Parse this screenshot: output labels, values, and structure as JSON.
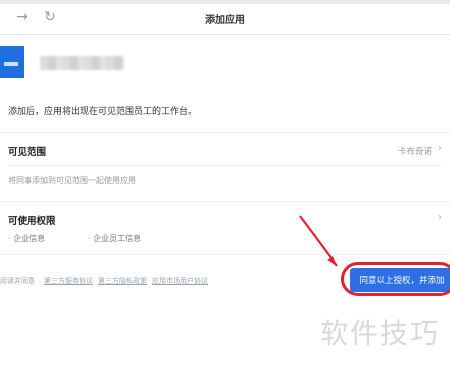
{
  "window": {
    "title": "添加应用",
    "back_icon": "arrow-right-icon",
    "refresh_icon": "refresh-icon"
  },
  "app": {
    "name": "",
    "icon": "app-icon"
  },
  "notice": "添加后，应用将出现在可见范围员工的工作台。",
  "visible_scope": {
    "title": "可见范围",
    "value": "卡布奇诺",
    "description": "将同事添加到可见范围一起使用应用"
  },
  "permissions": {
    "title": "可使用权限",
    "items": [
      "· 企业信息",
      "· 企业员工信息"
    ]
  },
  "footer": {
    "prefix": "阅读并同意",
    "links": [
      "第三方服务协议",
      "第三方隐私政策",
      "应用市场用户协议"
    ]
  },
  "agree_button": "同意以上授权，并添加",
  "watermark": "软件技巧",
  "colors": {
    "primary": "#2f6fe6",
    "annotation": "#e3232a"
  }
}
